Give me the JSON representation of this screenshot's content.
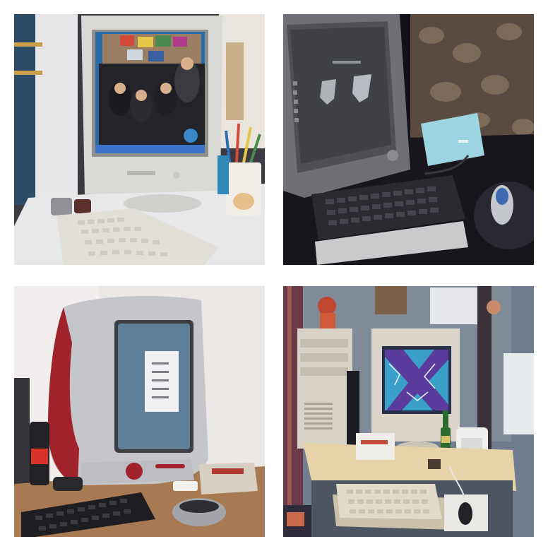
{
  "panels": [
    {
      "id": "crt-desk-photo"
    },
    {
      "id": "dark-desk-photo"
    },
    {
      "id": "imac-photo"
    },
    {
      "id": "tower-desk-photo"
    }
  ],
  "colors": {
    "background": "#ffffff",
    "beige_plastic": "#d9d6cc",
    "imac_red": "#a0232b",
    "dark_desk": "#15141a",
    "wallpaper_purple": "#5b3c9e"
  }
}
